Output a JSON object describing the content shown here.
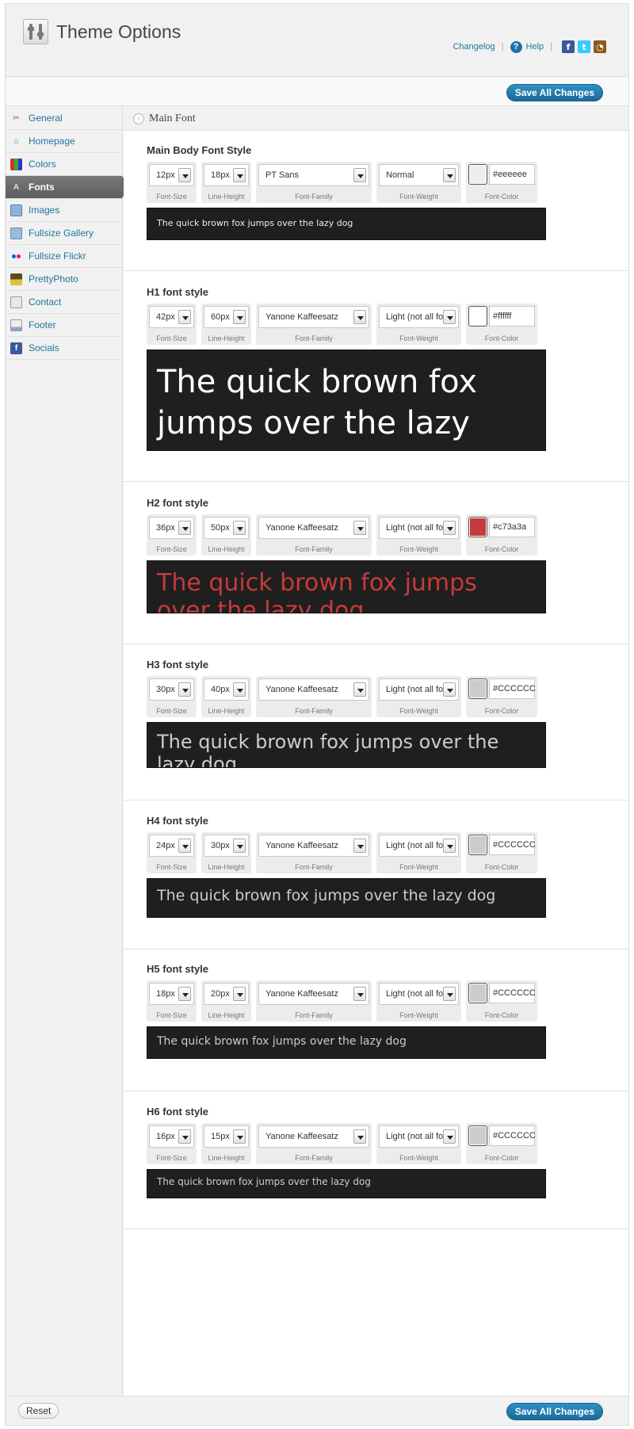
{
  "header": {
    "title": "Theme Options",
    "changelog_label": "Changelog",
    "help_label": "Help",
    "social_icons": [
      "facebook-icon",
      "twitter-icon",
      "rss-icon"
    ]
  },
  "actions": {
    "save_label": "Save All Changes",
    "reset_label": "Reset"
  },
  "sidebar": {
    "items": [
      {
        "label": "General",
        "icon": "tools-icon"
      },
      {
        "label": "Homepage",
        "icon": "home-icon"
      },
      {
        "label": "Colors",
        "icon": "palette-icon"
      },
      {
        "label": "Fonts",
        "icon": "font-icon",
        "active": true
      },
      {
        "label": "Images",
        "icon": "images-icon"
      },
      {
        "label": "Fullsize Gallery",
        "icon": "gallery-icon"
      },
      {
        "label": "Fullsize Flickr",
        "icon": "flickr-icon"
      },
      {
        "label": "PrettyPhoto",
        "icon": "prettyphoto-icon"
      },
      {
        "label": "Contact",
        "icon": "contact-icon"
      },
      {
        "label": "Footer",
        "icon": "footer-icon"
      },
      {
        "label": "Socials",
        "icon": "facebook-icon"
      }
    ]
  },
  "main": {
    "section_title": "Main Font",
    "captions": {
      "size": "Font-Size",
      "line_height": "Line-Height",
      "family": "Font-Family",
      "weight": "Font-Weight",
      "color": "Font-Color"
    },
    "preview_text": "The quick brown fox jumps over the lazy dog",
    "blocks": [
      {
        "title": "Main Body Font Style",
        "size": "12px",
        "line_height": "18px",
        "family": "PT Sans",
        "weight": "Normal",
        "color": "#eeeeee"
      },
      {
        "title": "H1 font style",
        "size": "42px",
        "line_height": "60px",
        "family": "Yanone Kaffeesatz",
        "weight": "Light (not all fonts",
        "color": "#ffffff"
      },
      {
        "title": "H2 font style",
        "size": "36px",
        "line_height": "50px",
        "family": "Yanone Kaffeesatz",
        "weight": "Light (not all fonts",
        "color": "#c73a3a"
      },
      {
        "title": "H3 font style",
        "size": "30px",
        "line_height": "40px",
        "family": "Yanone Kaffeesatz",
        "weight": "Light (not all fonts",
        "color": "#CCCCCC"
      },
      {
        "title": "H4 font style",
        "size": "24px",
        "line_height": "30px",
        "family": "Yanone Kaffeesatz",
        "weight": "Light (not all fonts",
        "color": "#CCCCCC"
      },
      {
        "title": "H5 font style",
        "size": "18px",
        "line_height": "20px",
        "family": "Yanone Kaffeesatz",
        "weight": "Light (not all fonts",
        "color": "#CCCCCC"
      },
      {
        "title": "H6 font style",
        "size": "16px",
        "line_height": "15px",
        "family": "Yanone Kaffeesatz",
        "weight": "Light (not all fonts",
        "color": "#CCCCCC"
      }
    ]
  }
}
